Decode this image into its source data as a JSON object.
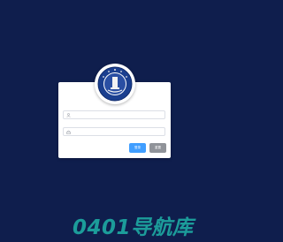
{
  "login": {
    "username_placeholder": "",
    "password_placeholder": "",
    "login_label": "登录",
    "reset_label": "重置"
  },
  "watermark": {
    "text": "0401导航库"
  },
  "colors": {
    "background": "#0f1e4d",
    "primary": "#409eff",
    "secondary": "#909399",
    "watermark": "#1fb3a8"
  },
  "icons": {
    "username": "user-icon",
    "password": "lock-icon",
    "logo": "school-emblem-icon"
  }
}
